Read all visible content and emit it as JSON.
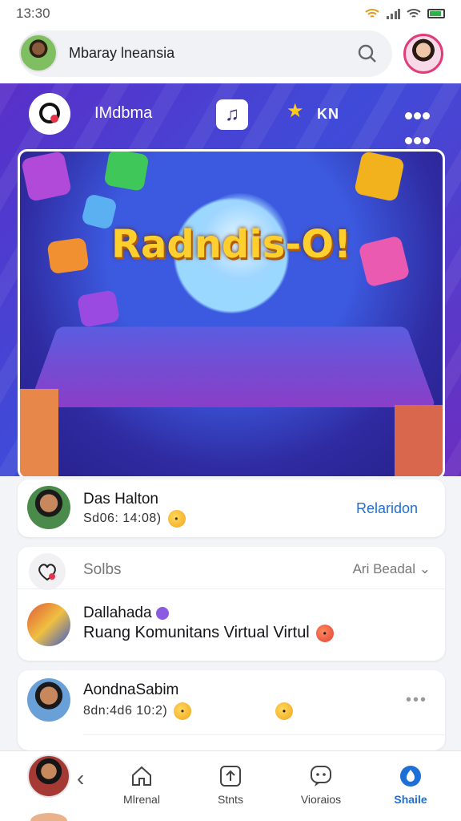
{
  "status_bar": {
    "time": "13:30"
  },
  "top_bar": {
    "search_label": "Mbaray lneansia"
  },
  "hero": {
    "app_title": "IMdbma",
    "header_icon_text": "KN",
    "banner_title": "Radndis-O!"
  },
  "cards": [
    {
      "name": "Das Halton",
      "subtitle": "Sd06: 14:08)",
      "action_label": "Relaridon"
    },
    {
      "section_label": "Solbs",
      "filter_label": "Ari Beadal",
      "post_author": "Dallahada",
      "post_text": "Ruang Komunitans Virtual Virtul"
    },
    {
      "name": "AondnaSabim",
      "subtitle": "8dn:4d6 10:2)"
    }
  ],
  "bottom_nav": {
    "items": [
      {
        "label": "Mlrenal",
        "icon": "home-icon"
      },
      {
        "label": "Stnts",
        "icon": "upload-icon"
      },
      {
        "label": "Vioraios",
        "icon": "chat-icon"
      },
      {
        "label": "Shaile",
        "icon": "drop-icon"
      }
    ]
  },
  "colors": {
    "accent": "#1e6fd8",
    "hero_bg": "#4b3fd0",
    "banner_title": "#ffcf2e"
  }
}
